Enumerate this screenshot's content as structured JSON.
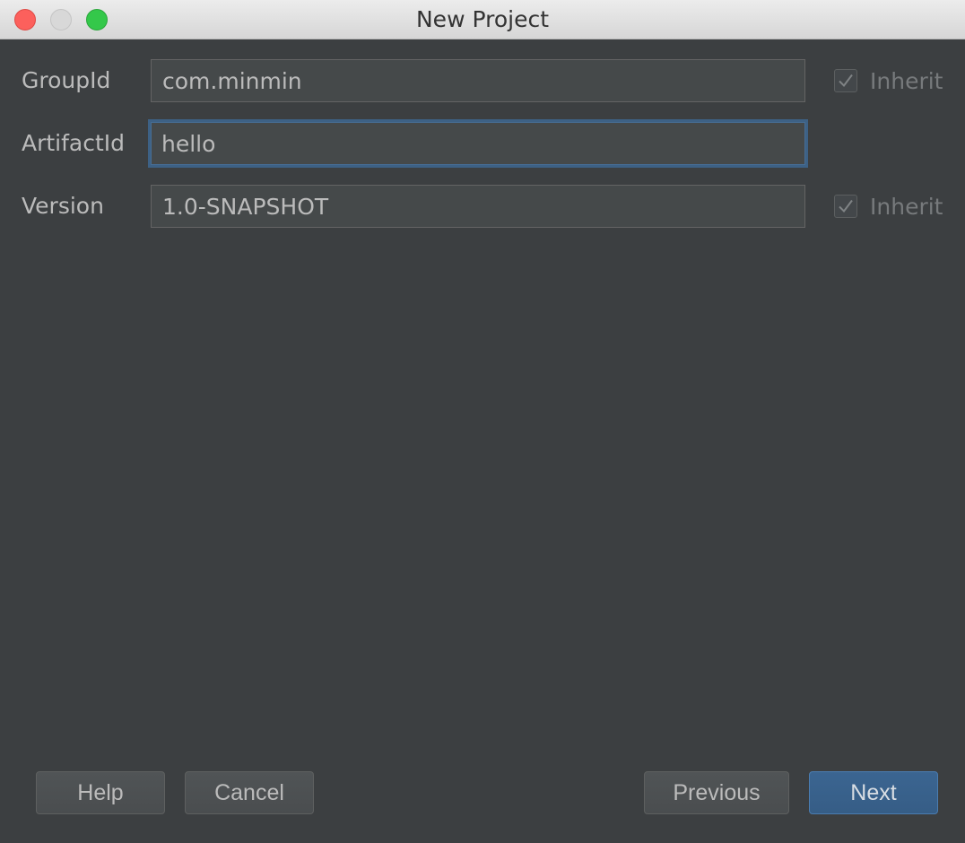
{
  "window": {
    "title": "New Project"
  },
  "form": {
    "group_id": {
      "label": "GroupId",
      "value": "com.minmin",
      "inherit_checked": true,
      "inherit_label": "Inherit"
    },
    "artifact_id": {
      "label": "ArtifactId",
      "value": "hello"
    },
    "version": {
      "label": "Version",
      "value": "1.0-SNAPSHOT",
      "inherit_checked": true,
      "inherit_label": "Inherit"
    }
  },
  "buttons": {
    "help": "Help",
    "cancel": "Cancel",
    "previous": "Previous",
    "next": "Next"
  },
  "colors": {
    "background": "#3c3f41",
    "field_background": "#45494a",
    "focus_border": "#3d6185",
    "primary_button": "#365d86",
    "text": "#bbbbbb"
  }
}
